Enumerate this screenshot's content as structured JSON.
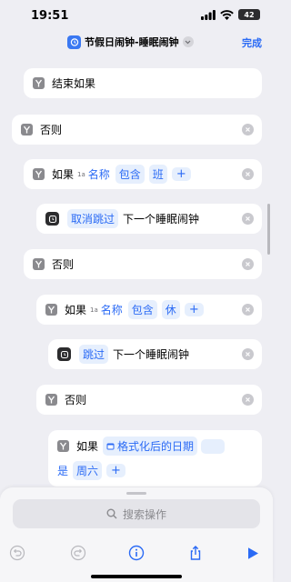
{
  "status": {
    "time": "19:51",
    "battery": "42"
  },
  "nav": {
    "title": "节假日闹钟-睡眠闹钟",
    "done": "完成"
  },
  "actions": [
    {
      "label": "结束如果"
    },
    {
      "label": "否则"
    },
    {
      "keyword": "如果",
      "variable": "名称",
      "operator": "包含",
      "value": "班",
      "plus": "+"
    },
    {
      "token": "取消跳过",
      "text": "下一个睡眠闹钟"
    },
    {
      "label": "否则"
    },
    {
      "keyword": "如果",
      "variable": "名称",
      "operator": "包含",
      "value": "休",
      "plus": "+"
    },
    {
      "token": "跳过",
      "text": "下一个睡眠闹钟"
    },
    {
      "label": "否则"
    },
    {
      "keyword": "如果",
      "variable": "格式化后的日期",
      "operator": "是",
      "value": "周六",
      "plus": "+"
    }
  ],
  "search": {
    "placeholder": "搜索操作"
  },
  "colors": {
    "accent": "#2a6af5",
    "background": "#eeeef3"
  }
}
